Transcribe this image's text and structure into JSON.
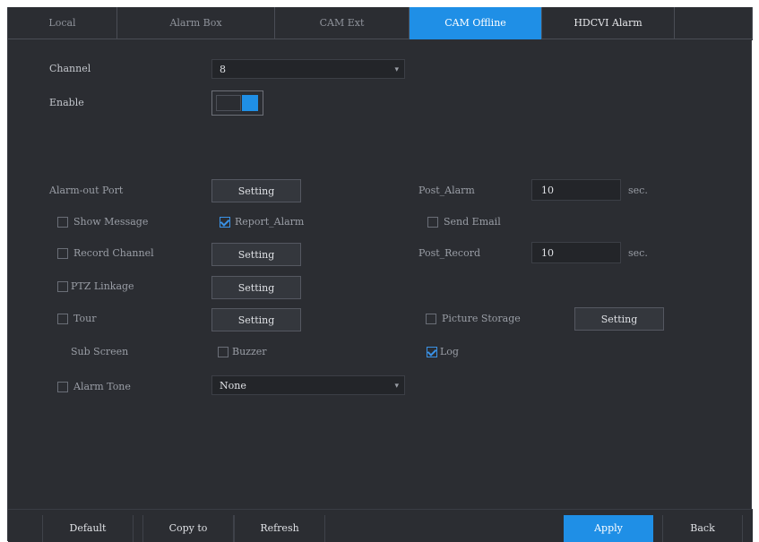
{
  "tabs": [
    {
      "label": "Local",
      "active": false
    },
    {
      "label": "Alarm Box",
      "active": false
    },
    {
      "label": "CAM Ext",
      "active": false
    },
    {
      "label": "CAM Offline",
      "active": true
    },
    {
      "label": "HDCVI Alarm",
      "active": false
    }
  ],
  "form": {
    "channel_label": "Channel",
    "channel_value": "8",
    "enable_label": "Enable",
    "enable_on": true,
    "alarm_out_port_label": "Alarm-out Port",
    "alarm_out_setting": "Setting",
    "post_alarm_label": "Post_Alarm",
    "post_alarm_value": "10",
    "post_alarm_unit": "sec.",
    "show_message_label": "Show Message",
    "show_message_checked": false,
    "report_alarm_label": "Report_Alarm",
    "report_alarm_checked": true,
    "send_email_label": "Send Email",
    "send_email_checked": false,
    "record_channel_label": "Record Channel",
    "record_channel_checked": false,
    "record_channel_setting": "Setting",
    "post_record_label": "Post_Record",
    "post_record_value": "10",
    "post_record_unit": "sec.",
    "ptz_linkage_label": "PTZ Linkage",
    "ptz_linkage_checked": false,
    "ptz_setting": "Setting",
    "tour_label": "Tour",
    "tour_checked": false,
    "tour_setting": "Setting",
    "picture_storage_label": "Picture Storage",
    "picture_storage_checked": false,
    "picture_setting": "Setting",
    "sub_screen_label": "Sub Screen",
    "buzzer_label": "Buzzer",
    "buzzer_checked": false,
    "log_label": "Log",
    "log_checked": true,
    "alarm_tone_label": "Alarm Tone",
    "alarm_tone_checked": false,
    "alarm_tone_value": "None"
  },
  "footer": {
    "default": "Default",
    "copy_to": "Copy to",
    "refresh": "Refresh",
    "apply": "Apply",
    "back": "Back"
  },
  "colors": {
    "accent": "#1f8fe6",
    "panel": "#2b2d32"
  }
}
